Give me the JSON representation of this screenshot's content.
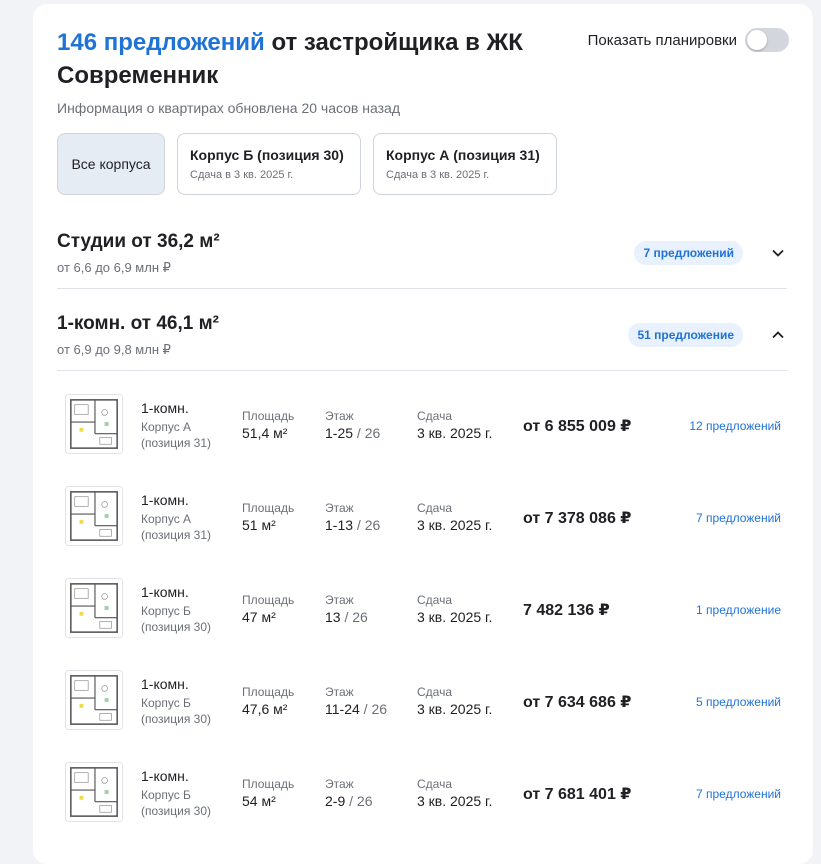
{
  "header": {
    "count_text": "146 предложений",
    "title_rest": " от застройщика в ЖК Современник",
    "updated_text": "Информация о квартирах обновлена 20 часов назад",
    "toggle_label": "Показать планировки",
    "toggle_on": false
  },
  "filters": [
    {
      "label": "Все корпуса",
      "sub": "",
      "active": true
    },
    {
      "label": "Корпус Б (позиция 30)",
      "sub": "Сдача в 3 кв. 2025 г.",
      "active": false
    },
    {
      "label": "Корпус А (позиция 31)",
      "sub": "Сдача в 3 кв. 2025 г.",
      "active": false
    }
  ],
  "groups": [
    {
      "title": "Студии от 36,2 м²",
      "range": "от 6,6 до 6,9 млн ₽",
      "badge": "7 предложений",
      "expanded": false,
      "chevron_icon": "chevron-down-icon"
    },
    {
      "title": "1-комн. от 46,1 м²",
      "range": "от 6,9 до 9,8 млн ₽",
      "badge": "51 предложение",
      "expanded": true,
      "chevron_icon": "chevron-up-icon"
    }
  ],
  "column_labels": {
    "area": "Площадь",
    "floor": "Этаж",
    "delivery": "Сдача"
  },
  "listings": [
    {
      "type": "1-комн.",
      "building": "Корпус А (позиция 31)",
      "area": "51,4 м²",
      "floor": "1-25",
      "floors_total": "/ 26",
      "delivery": "3 кв. 2025 г.",
      "price": "от 6 855 009 ₽",
      "offers": "12 предложений"
    },
    {
      "type": "1-комн.",
      "building": "Корпус А (позиция 31)",
      "area": "51 м²",
      "floor": "1-13",
      "floors_total": "/ 26",
      "delivery": "3 кв. 2025 г.",
      "price": "от 7 378 086 ₽",
      "offers": "7 предложений"
    },
    {
      "type": "1-комн.",
      "building": "Корпус Б (позиция 30)",
      "area": "47 м²",
      "floor": "13",
      "floors_total": "/ 26",
      "delivery": "3 кв. 2025 г.",
      "price": "7 482 136 ₽",
      "offers": "1 предложение"
    },
    {
      "type": "1-комн.",
      "building": "Корпус Б (позиция 30)",
      "area": "47,6 м²",
      "floor": "11-24",
      "floors_total": "/ 26",
      "delivery": "3 кв. 2025 г.",
      "price": "от 7 634 686 ₽",
      "offers": "5 предложений"
    },
    {
      "type": "1-комн.",
      "building": "Корпус Б (позиция 30)",
      "area": "54 м²",
      "floor": "2-9",
      "floors_total": "/ 26",
      "delivery": "3 кв. 2025 г.",
      "price": "от 7 681 401 ₽",
      "offers": "7 предложений"
    }
  ],
  "colors": {
    "accent": "#1f72d6",
    "badge_bg": "#e8f1fd",
    "active_filter_bg": "#e6ecf3"
  }
}
